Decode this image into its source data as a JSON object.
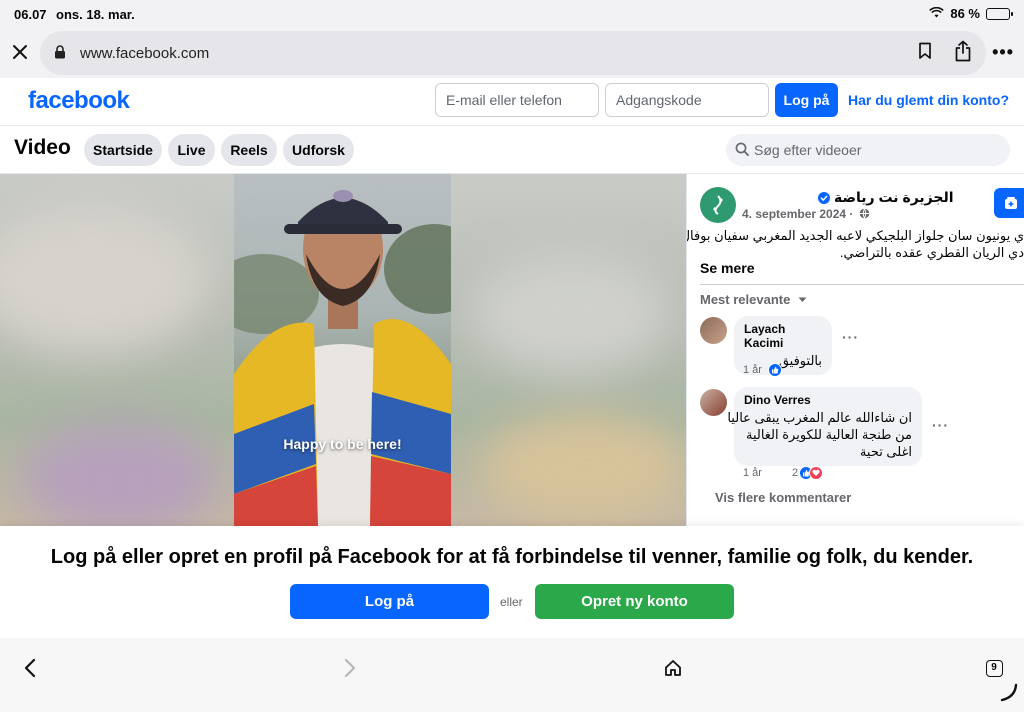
{
  "status": {
    "time": "06.07",
    "date": "ons. 18. mar.",
    "battery": "86 %",
    "battery_level": 0.86
  },
  "browser": {
    "url": "www.facebook.com"
  },
  "header": {
    "logo": "facebook",
    "email_placeholder": "E-mail eller telefon",
    "password_placeholder": "Adgangskode",
    "login_label": "Log på",
    "forgot_label": "Har du glemt din konto?"
  },
  "videonav": {
    "title": "Video",
    "tabs": [
      {
        "label": "Startside"
      },
      {
        "label": "Live"
      },
      {
        "label": "Reels"
      },
      {
        "label": "Udforsk"
      }
    ],
    "search_placeholder": "Søg efter videoer"
  },
  "video": {
    "caption": "Happy to be here!"
  },
  "post": {
    "page_name": "الجزيرة نت رياضة",
    "date": "4. september 2024 ·",
    "text_line1": "ي يونيون سان جلواز البلجيكي لاعبه الجديد المغربي سفيان بوفال",
    "text_line2": "دي الريان القطري عقده بالتراضي.",
    "see_more": "Se mere",
    "sort_label": "Mest relevante"
  },
  "comments": [
    {
      "name": "Layach Kacimi",
      "lines": [
        "بالتوفيق"
      ],
      "age": "1 år",
      "count": ""
    },
    {
      "name": "Dino Verres",
      "lines": [
        "ان شاءالله عالم المغرب يبقى عاليا",
        "من طنجة العالية للكويرة الغالية",
        "اغلى تحية"
      ],
      "age": "1 år",
      "count": "2"
    }
  ],
  "more_comments": "Vis flere kommentarer",
  "banner": {
    "message": "Log på eller opret en profil på Facebook for at få forbindelse til venner, familie og folk, du kender.",
    "login_label": "Log på",
    "or_label": "eller",
    "create_label": "Opret ny konto"
  },
  "toolbar": {
    "tab_count": "9"
  },
  "colors": {
    "brand": "#0866ff",
    "create": "#2ba84a"
  }
}
